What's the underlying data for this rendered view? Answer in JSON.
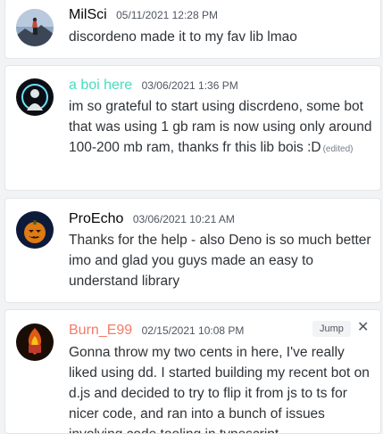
{
  "messages": [
    {
      "author": "MilSci",
      "author_color": "#060607",
      "timestamp": "05/11/2021 12:28 PM",
      "text": "discordeno made it to my fav lib lmao",
      "avatar": "mountain-silhouette"
    },
    {
      "author": "a boi here",
      "author_color": "#45ddc0",
      "timestamp": "03/06/2021 1:36 PM",
      "text": "im so grateful to start using discrdeno, some bot that was using 1 gb ram is now using only around 100-200 mb ram, thanks fr this lib bois :D",
      "edited": "(edited)",
      "avatar": "glowing-silhouette"
    },
    {
      "author": "ProEcho",
      "author_color": "#060607",
      "timestamp": "03/06/2021 10:21 AM",
      "text": "Thanks for the help - also Deno is so much better imo and glad you guys made an easy to understand library",
      "avatar": "pumpkin"
    },
    {
      "author": "Burn_E99",
      "author_color": "#f47b67",
      "timestamp": "02/15/2021 10:08 PM",
      "text": "Gonna throw my two cents in here, I've really liked using dd.  I started building my recent bot on d.js and decided to try to flip it from js to ts for nicer code, and ran into a bunch of issues involving code tooling in typescript",
      "avatar": "fire-logo"
    }
  ],
  "actions": {
    "jump_label": "Jump",
    "close_icon": "close-icon"
  }
}
